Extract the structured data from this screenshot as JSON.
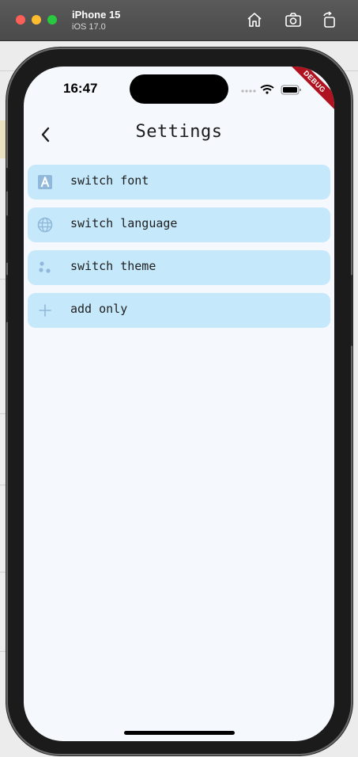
{
  "simulator": {
    "device_name": "iPhone 15",
    "os_version": "iOS 17.0"
  },
  "status_bar": {
    "time": "16:47",
    "debug_label": "DEBUG"
  },
  "header": {
    "title": "Settings",
    "back_icon": "chevron-left-icon"
  },
  "settings": {
    "items": [
      {
        "label": "switch font",
        "icon": "font-icon"
      },
      {
        "label": "switch language",
        "icon": "globe-icon"
      },
      {
        "label": "switch theme",
        "icon": "palette-dots-icon"
      },
      {
        "label": "add only",
        "icon": "plus-icon"
      }
    ]
  },
  "colors": {
    "item_background": "#c6e8fb",
    "icon_color": "#8fb8da",
    "screen_background": "#f5f8fc",
    "debug_banner": "#b0131f"
  }
}
